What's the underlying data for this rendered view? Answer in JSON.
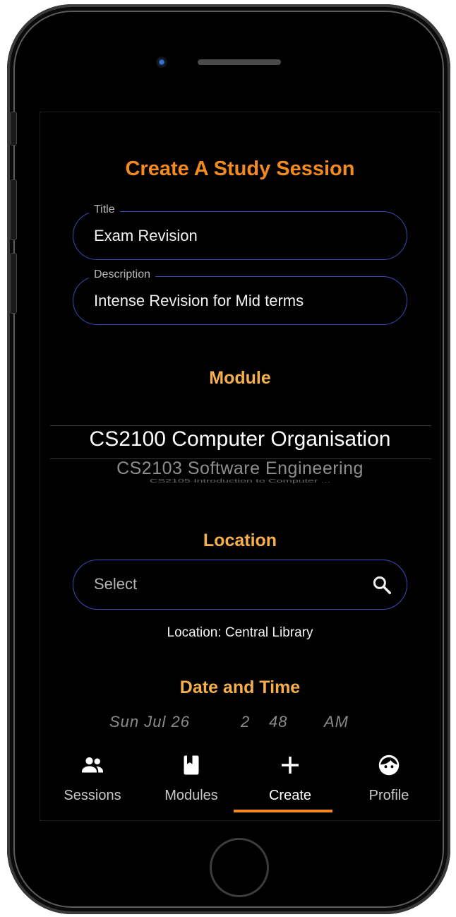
{
  "page": {
    "title": "Create A Study Session"
  },
  "form": {
    "title_label": "Title",
    "title_value": "Exam Revision",
    "description_label": "Description",
    "description_value": "Intense Revision for Mid terms"
  },
  "module": {
    "heading": "Module",
    "options": [
      "CS2100 Computer Organisation",
      "CS2103 Software Engineering",
      "CS2105 Introduction to Computer ..."
    ],
    "selected": "CS2100 Computer Organisation"
  },
  "location": {
    "heading": "Location",
    "search_placeholder": "Select",
    "current": "Location: Central Library"
  },
  "datetime": {
    "heading": "Date and Time",
    "day": "Sun Jul 26",
    "hour": "2",
    "minute": "48",
    "ampm": "AM"
  },
  "nav": {
    "items": [
      {
        "label": "Sessions",
        "icon": "people-icon"
      },
      {
        "label": "Modules",
        "icon": "book-icon"
      },
      {
        "label": "Create",
        "icon": "plus-icon"
      },
      {
        "label": "Profile",
        "icon": "face-icon"
      }
    ],
    "active": "Create"
  },
  "colors": {
    "accent": "#f28a1f",
    "section_heading": "#f5b04b",
    "field_border": "#3b4bb8",
    "background": "#000000"
  }
}
